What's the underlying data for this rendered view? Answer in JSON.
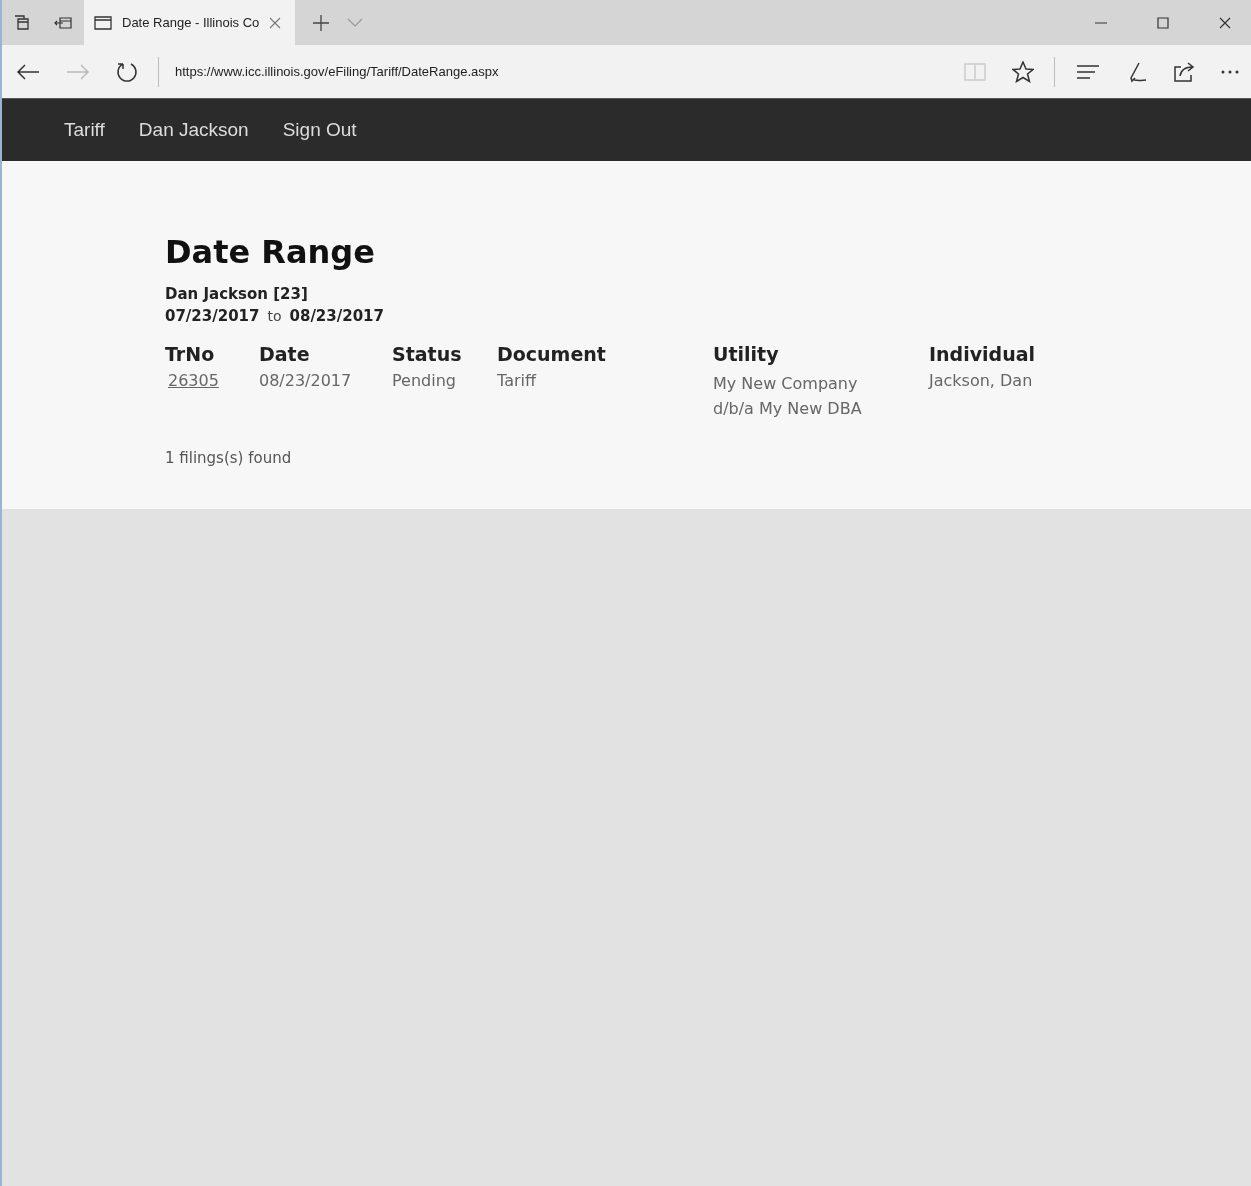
{
  "browser": {
    "tabs": [
      {
        "title": "Date Range - Illinois Co",
        "selected": true
      }
    ],
    "address": "https://www.icc.illinois.gov/eFiling/Tariff/DateRange.aspx",
    "forward_disabled": true
  },
  "nav": {
    "links": [
      "Tariff",
      "Dan Jackson",
      "Sign Out"
    ]
  },
  "page": {
    "title": "Date Range",
    "user": "Dan Jackson [23]",
    "from": "07/23/2017",
    "to_label": "to",
    "to": "08/23/2017",
    "table": {
      "columns": [
        "TrNo",
        "Date",
        "Status",
        "Document",
        "Utility",
        "Individual"
      ],
      "rows": [
        {
          "trno": "26305",
          "date": "08/23/2017",
          "status": "Pending",
          "document": "Tariff",
          "utility": "My New Company d/b/a My New DBA",
          "individual": "Jackson, Dan"
        }
      ]
    },
    "footer": "1 filings(s) found"
  }
}
